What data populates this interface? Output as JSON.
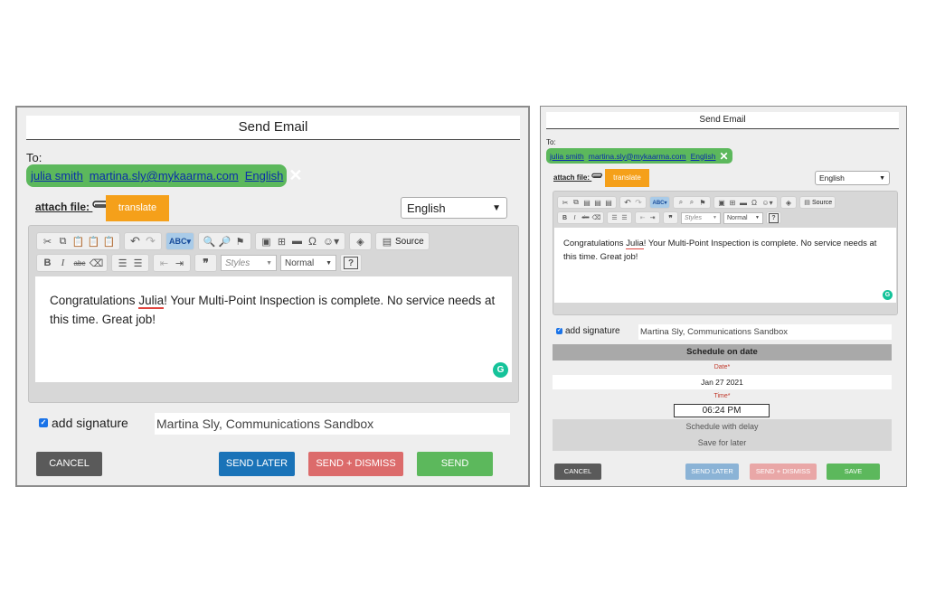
{
  "dialog": {
    "title": "Send Email",
    "to_label": "To:",
    "recipients": [
      "julia smith",
      "martina.sly@mykaarma.com",
      "English"
    ],
    "remove_icon": "close-x-icon",
    "attach_label": "attach file:",
    "attach_icon": "paperclip-icon",
    "translate_label": "translate",
    "language_selected": "English",
    "toolbar": {
      "source_label": "Source",
      "styles_placeholder": "Styles",
      "format_value": "Normal",
      "help_label": "?"
    },
    "message_text": "Congratulations",
    "message_name": "Julia",
    "message_rest": "! Your Multi-Point Inspection is complete. No service needs at this time. Great job!",
    "signature_label": "add signature",
    "signature_checked": true,
    "signature_value": "Martina Sly, Communications Sandbox",
    "buttons": {
      "cancel": "CANCEL",
      "send_later": "SEND LATER",
      "send_dismiss": "SEND + DISMISS",
      "send": "SEND",
      "save": "SAVE"
    },
    "colors": {
      "cancel": "#5a5a5a",
      "send_later": "#1a73b8",
      "send_dismiss": "#dc6b6b",
      "send": "#5cb85c",
      "translate": "#f5a01a"
    }
  },
  "schedule": {
    "title": "Schedule on date",
    "date_label": "Date*",
    "date_value": "Jan 27 2021",
    "time_label": "Time*",
    "time_value": "06:24 PM",
    "delay_label": "Schedule with delay",
    "save_label": "Save for later"
  }
}
